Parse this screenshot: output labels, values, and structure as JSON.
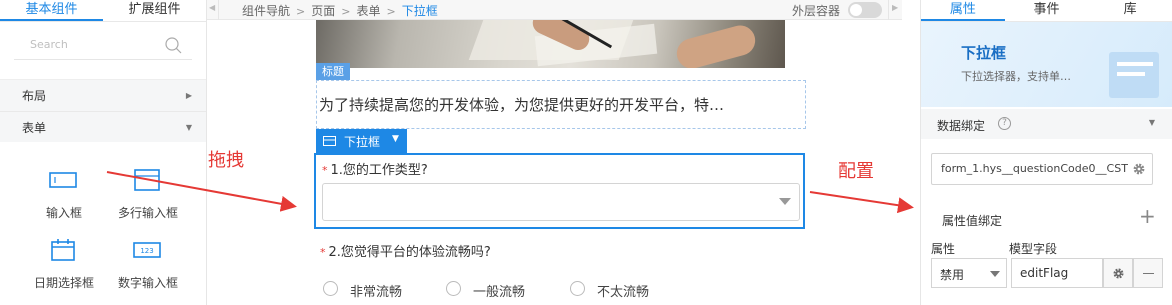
{
  "left_panel": {
    "tabs": [
      "基本组件",
      "扩展组件"
    ],
    "search_placeholder": "Search",
    "categories": [
      {
        "label": "布局",
        "state": "collapsed"
      },
      {
        "label": "表单",
        "state": "expanded"
      }
    ],
    "components": [
      {
        "label": "输入框",
        "icon": "input-box-icon"
      },
      {
        "label": "多行输入框",
        "icon": "textarea-icon"
      },
      {
        "label": "日期选择框",
        "icon": "calendar-icon"
      },
      {
        "label": "数字输入框",
        "icon": "number-input-icon"
      }
    ]
  },
  "header": {
    "breadcrumb": [
      "组件导航",
      "页面",
      "表单",
      "下拉框"
    ],
    "outer_container_label": "外层容器",
    "outer_container_on": false
  },
  "canvas": {
    "title_tag": "标题",
    "title_text": "为了持续提高您的开发体验，为您提供更好的开发平台，特…",
    "selected_tag": "下拉框",
    "q1": "1.您的工作类型?",
    "q2": "2.您觉得平台的体验流畅吗?",
    "q2_options": [
      "非常流畅",
      "一般流畅",
      "不太流畅"
    ],
    "required_mark": "*"
  },
  "annotations": {
    "drag": "拖拽",
    "configure": "配置",
    "color": "#e53935"
  },
  "right_panel": {
    "tabs": [
      "属性",
      "事件",
      "库"
    ],
    "hero_title": "下拉框",
    "hero_subtitle": "下拉选择器，支持单…",
    "section_label": "数据绑定",
    "help_icon_glyph": "?",
    "data_binding_value": "form_1.hys__questionCode0__CST",
    "property_binding_label": "属性值绑定",
    "add_glyph": "+",
    "col_property": "属性",
    "col_model_field": "模型字段",
    "property_value": "禁用",
    "model_field_value": "editFlag"
  },
  "colors": {
    "accent": "#1e88e5",
    "required": "#e53935"
  }
}
